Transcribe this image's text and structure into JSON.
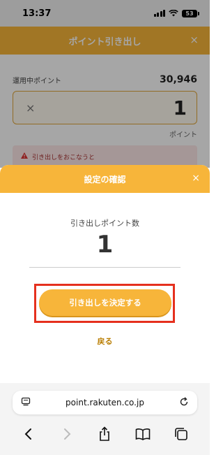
{
  "status_bar": {
    "time": "13:37",
    "battery": "53"
  },
  "background_page": {
    "title": "ポイント引き出し",
    "close": "×",
    "available_label": "運用中ポイント",
    "available_value": "30,946",
    "input_clear": "×",
    "input_value": "1",
    "unit_label": "ポイント",
    "warning_text": "引き出しをおこなうと"
  },
  "modal": {
    "title": "設定の確認",
    "close": "×",
    "points_label": "引き出しポイント数",
    "points_value": "1",
    "confirm_button": "引き出しを決定する",
    "back_link": "戻る"
  },
  "browser": {
    "url": "point.rakuten.co.jp"
  },
  "colors": {
    "accent": "#f7b53a",
    "highlight_frame": "#e5301e",
    "link": "#b97d00"
  },
  "icons": [
    "signal-icon",
    "wifi-icon",
    "battery-icon",
    "reader-icon",
    "reload-icon",
    "back-icon",
    "forward-icon",
    "share-icon",
    "bookmarks-icon",
    "tabs-icon"
  ]
}
